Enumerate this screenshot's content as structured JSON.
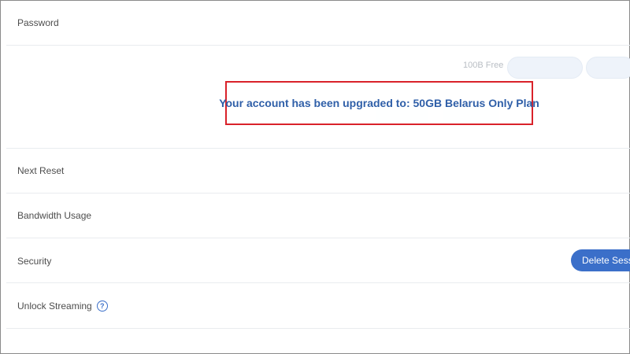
{
  "settings": {
    "password_label": "Password",
    "next_reset_label": "Next Reset",
    "bandwidth_label": "Bandwidth Usage",
    "security_label": "Security",
    "delete_sessions_label": "Delete Sessio",
    "unlock_streaming_label": "Unlock Streaming",
    "help_glyph": "?"
  },
  "notice": {
    "text": "Your account has been upgraded to: 50GB Belarus Only Plan",
    "border_color": "#d9222a",
    "text_color": "#2f5fa8"
  },
  "background": {
    "free_text": "100B Free"
  },
  "colors": {
    "accent": "#3b6fc9"
  }
}
